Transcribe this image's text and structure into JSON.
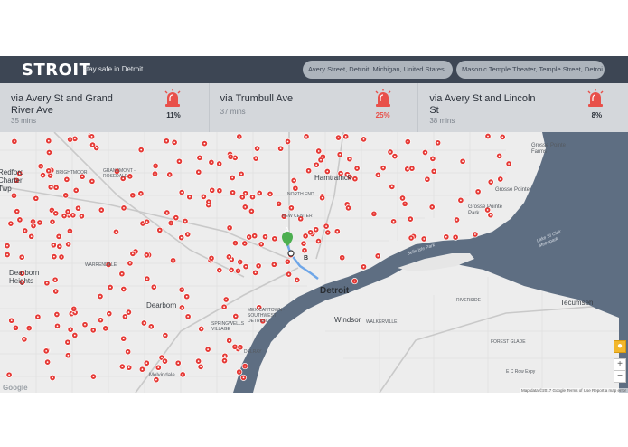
{
  "app": {
    "title": "STROIT",
    "tagline": "stay safe in Detroit"
  },
  "search": {
    "origin": "Avery Street, Detroit, Michigan, United States",
    "destination": "Masonic Temple Theater, Temple Street, Detroi"
  },
  "routes": [
    {
      "name": "via Avery St and Grand River Ave",
      "time": "35 mins",
      "risk": "11%",
      "icon": "siren-icon"
    },
    {
      "name": "via Trumbull Ave",
      "time": "37 mins",
      "risk": "25%",
      "icon": "siren-icon"
    },
    {
      "name": "via Avery St and Lincoln St",
      "time": "38 mins",
      "risk": "8%",
      "icon": "siren-icon"
    }
  ],
  "colors": {
    "topbar": "#3d4654",
    "route_bar": "#d4d7db",
    "siren": "#e8504a",
    "water": "#5e6e82",
    "incident": "#e53935"
  },
  "map": {
    "labels": {
      "hamtramck": "Hamtramck",
      "detroit": "Detroit",
      "windsor": "Windsor",
      "dearborn": "Dearborn",
      "redford": "Redford Charter Twp",
      "dearborn_heights": "Dearborn Heights",
      "melvindale": "Melvindale",
      "tecumseh": "Tecumseh",
      "grosse_pointe": "Grosse Pointe",
      "grosse_pointe_park": "Grosse Pointe Park",
      "grosse_pointe_farms": "Grosse Pointe Farms",
      "brightmoor": "BRIGHTMOOR",
      "grandmont": "GRANDMONT - ROSEDALE",
      "warrendale": "WARRENDALE",
      "north_end": "NORTH END",
      "new_center": "NEW CENTER",
      "springwells": "SPRINGWELLS VILLAGE",
      "mexicantown": "MEXICANTOWN - SOUTHWEST DETROIT",
      "delray": "DELRAY",
      "walkerville": "WALKERVILLE",
      "riverside": "RIVERSIDE",
      "forest_glade": "FOREST GLADE",
      "belle_isle": "Belle Isle Park",
      "lake_st_clair": "Lake St Clair Metropark",
      "ec_row": "E C Row Expy"
    },
    "markers": {
      "start": "A",
      "end": "B"
    },
    "controls": {
      "pegman": "pegman-icon",
      "zoom_in": "+",
      "zoom_out": "−"
    },
    "google": "Google",
    "attribution": "Map data ©2017 Google   Terms of Use   Report a map error"
  }
}
